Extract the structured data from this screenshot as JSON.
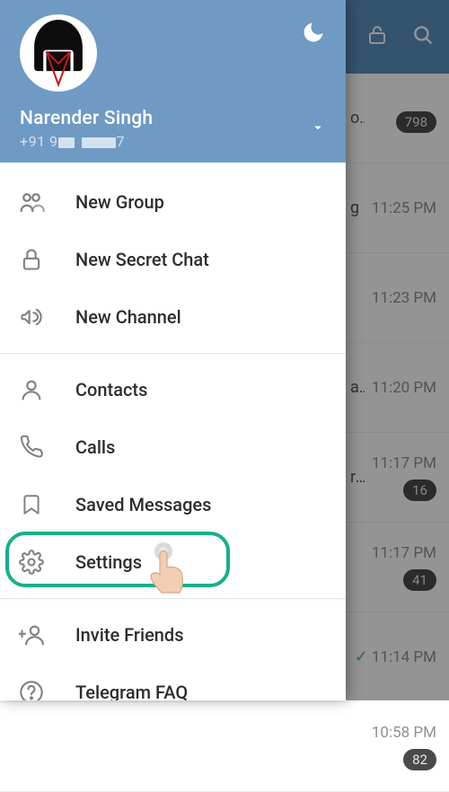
{
  "profile": {
    "name": "Narender Singh",
    "phone_prefix": "+91 9",
    "phone_suffix": "7"
  },
  "menu": {
    "new_group": "New Group",
    "new_secret_chat": "New Secret Chat",
    "new_channel": "New Channel",
    "contacts": "Contacts",
    "calls": "Calls",
    "saved_messages": "Saved Messages",
    "settings": "Settings",
    "invite_friends": "Invite Friends",
    "telegram_faq": "Telegram FAQ"
  },
  "chats": [
    {
      "snippet": "o…",
      "time": "",
      "badge": "798"
    },
    {
      "snippet": "g",
      "time": "11:25 PM",
      "badge": ""
    },
    {
      "snippet": "",
      "time": "11:23 PM",
      "badge": ""
    },
    {
      "snippet": "ate? N…",
      "time": "11:20 PM",
      "badge": ""
    },
    {
      "snippet": "ra…",
      "time": "11:17 PM",
      "badge": "16"
    },
    {
      "snippet": "",
      "time": "11:17 PM",
      "badge": "41"
    },
    {
      "snippet": "",
      "time": "11:14 PM",
      "badge": "",
      "sent": true
    },
    {
      "snippet": "",
      "time": "10:58 PM",
      "badge": "82"
    }
  ]
}
